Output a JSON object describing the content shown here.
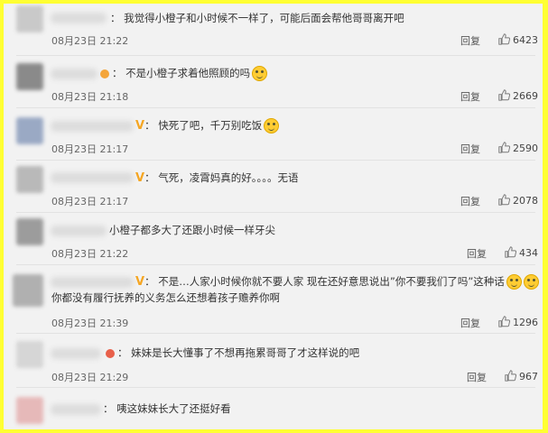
{
  "comments": [
    {
      "text": "我觉得小橙子和小时候不一样了，可能后面会帮他哥哥离开吧",
      "prefix": "：",
      "badge": "",
      "time": "08月23日 21:22",
      "reply": "回复",
      "likes": "6423",
      "emoji": false
    },
    {
      "text": "不是小橙子求着他照顾的吗",
      "prefix": "：",
      "badge": "emoji",
      "time": "08月23日 21:18",
      "reply": "回复",
      "likes": "2669",
      "emoji": true
    },
    {
      "text": "快死了吧，千万别吃饭",
      "prefix": "：",
      "badge": "V",
      "time": "08月23日 21:17",
      "reply": "回复",
      "likes": "2590",
      "emoji": true
    },
    {
      "text": "气死，凌霄妈真的好。。。。无语",
      "prefix": "：",
      "badge": "V",
      "time": "08月23日 21:17",
      "reply": "回复",
      "likes": "2078",
      "emoji": false
    },
    {
      "text": "小橙子都多大了还跟小时候一样牙尖",
      "prefix": "",
      "badge": "",
      "time": "08月23日 21:22",
      "reply": "回复",
      "likes": "434",
      "emoji": false
    },
    {
      "text": "不是…人家小时候你就不要人家 现在还好意思说出”你不要我们了吗”这种话",
      "line2": "你都没有履行抚养的义务怎么还想着孩子赡养你啊",
      "prefix": "：",
      "badge": "V",
      "time": "08月23日 21:39",
      "reply": "回复",
      "likes": "1296",
      "emoji": true
    },
    {
      "text": "妹妹是长大懂事了不想再拖累哥哥了才这样说的吧",
      "prefix": "：",
      "badge": "emoji",
      "time": "08月23日 21:29",
      "reply": "回复",
      "likes": "967",
      "emoji": false
    },
    {
      "text": "咦这妹妹长大了还挺好看",
      "prefix": "：",
      "badge": "",
      "time": "",
      "reply": "",
      "likes": "",
      "emoji": false
    }
  ]
}
